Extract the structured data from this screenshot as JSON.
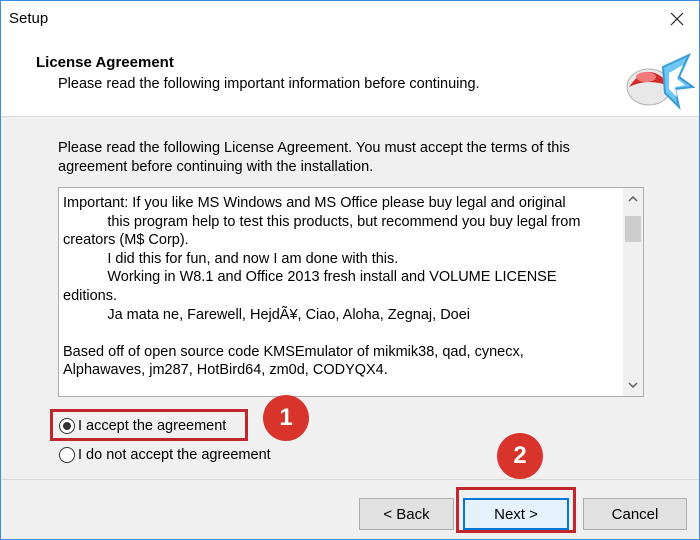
{
  "window": {
    "title": "Setup"
  },
  "header": {
    "title": "License Agreement",
    "subtitle": "Please read the following important information before continuing."
  },
  "intro": "Please read the following License Agreement. You must accept the terms of this agreement before continuing with the installation.",
  "license_text": "Important: If you like MS Windows and MS Office please buy legal and original\n           this program help to test this products, but recommend you buy legal from\ncreators (M$ Corp).\n           I did this for fun, and now I am done with this.\n           Working in W8.1 and Office 2013 fresh install and VOLUME LICENSE\neditions.\n           Ja mata ne, Farewell, HejdÃ¥, Ciao, Aloha, Zegnaj, Doei\n\nBased off of open source code KMSEmulator of mikmik38, qad, cynecx,\nAlphawaves, jm287, HotBird64, zm0d, CODYQX4.",
  "radios": {
    "accept_label": "I accept the agreement",
    "decline_label": "I do not accept the agreement",
    "selected": "accept"
  },
  "annotations": {
    "badge_1": "1",
    "badge_2": "2",
    "highlight_color": "#c0262c"
  },
  "buttons": {
    "back": "< Back",
    "next": "Next >",
    "cancel": "Cancel"
  },
  "icons": {
    "close": "close-icon",
    "logo": "setup-logo-icon",
    "scroll_up": "chevron-up-icon",
    "scroll_down": "chevron-down-icon"
  }
}
